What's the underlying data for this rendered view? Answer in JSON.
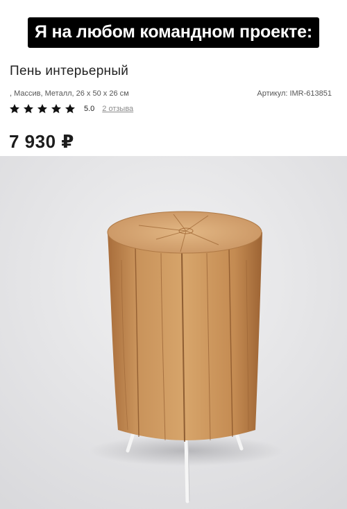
{
  "meme": {
    "caption": "Я на любом командном проекте:"
  },
  "product": {
    "title": "Пень интерьерный",
    "specs": ", Массив, Металл, 26 x 50 x 26 см",
    "sku_label": "Артикул:",
    "sku_value": "IMR-613851",
    "rating_value": "5.0",
    "stars": 5,
    "reviews_link": "2 отзыва",
    "price": "7 930 ₽"
  },
  "icons": {
    "star": "star-icon"
  },
  "colors": {
    "caption_bg": "#000000",
    "caption_text": "#ffffff",
    "backdrop": "#e6e6e8",
    "wood": "#c8925a"
  }
}
